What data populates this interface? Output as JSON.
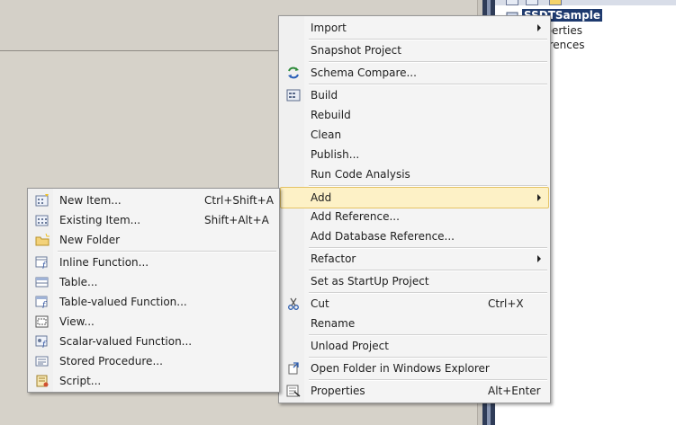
{
  "solution_explorer": {
    "project_label": "SSDTSample",
    "properties_label": "operties",
    "references_label": "ferences"
  },
  "context_menu": {
    "items": [
      {
        "label": "Import",
        "shortcut": "",
        "submenu": true,
        "icon": ""
      },
      {
        "label": "Snapshot Project",
        "shortcut": "",
        "submenu": false,
        "icon": ""
      },
      {
        "label": "Schema Compare...",
        "shortcut": "",
        "submenu": false,
        "icon": "schema-compare-icon"
      },
      {
        "label": "Build",
        "shortcut": "",
        "submenu": false,
        "icon": "build-icon"
      },
      {
        "label": "Rebuild",
        "shortcut": "",
        "submenu": false,
        "icon": ""
      },
      {
        "label": "Clean",
        "shortcut": "",
        "submenu": false,
        "icon": ""
      },
      {
        "label": "Publish...",
        "shortcut": "",
        "submenu": false,
        "icon": ""
      },
      {
        "label": "Run Code Analysis",
        "shortcut": "",
        "submenu": false,
        "icon": ""
      },
      {
        "label": "Add",
        "shortcut": "",
        "submenu": true,
        "icon": "",
        "highlighted": true
      },
      {
        "label": "Add Reference...",
        "shortcut": "",
        "submenu": false,
        "icon": ""
      },
      {
        "label": "Add Database Reference...",
        "shortcut": "",
        "submenu": false,
        "icon": ""
      },
      {
        "label": "Refactor",
        "shortcut": "",
        "submenu": true,
        "icon": ""
      },
      {
        "label": "Set as StartUp Project",
        "shortcut": "",
        "submenu": false,
        "icon": ""
      },
      {
        "label": "Cut",
        "shortcut": "Ctrl+X",
        "submenu": false,
        "icon": "scissors-icon"
      },
      {
        "label": "Rename",
        "shortcut": "",
        "submenu": false,
        "icon": ""
      },
      {
        "label": "Unload Project",
        "shortcut": "",
        "submenu": false,
        "icon": ""
      },
      {
        "label": "Open Folder in Windows Explorer",
        "shortcut": "",
        "submenu": false,
        "icon": "open-folder-icon"
      },
      {
        "label": "Properties",
        "shortcut": "Alt+Enter",
        "submenu": false,
        "icon": "properties-icon"
      }
    ]
  },
  "add_submenu": {
    "items": [
      {
        "label": "New Item...",
        "shortcut": "Ctrl+Shift+A",
        "icon": "new-item-icon"
      },
      {
        "label": "Existing Item...",
        "shortcut": "Shift+Alt+A",
        "icon": "existing-item-icon"
      },
      {
        "label": "New Folder",
        "shortcut": "",
        "icon": "new-folder-icon"
      },
      {
        "label": "Inline Function...",
        "shortcut": "",
        "icon": "inline-function-icon"
      },
      {
        "label": "Table...",
        "shortcut": "",
        "icon": "table-icon"
      },
      {
        "label": "Table-valued Function...",
        "shortcut": "",
        "icon": "table-valued-function-icon"
      },
      {
        "label": "View...",
        "shortcut": "",
        "icon": "view-icon"
      },
      {
        "label": "Scalar-valued Function...",
        "shortcut": "",
        "icon": "scalar-function-icon"
      },
      {
        "label": "Stored Procedure...",
        "shortcut": "",
        "icon": "stored-procedure-icon"
      },
      {
        "label": "Script...",
        "shortcut": "",
        "icon": "script-icon"
      }
    ]
  },
  "colors": {
    "highlight_bg": "#fdf1c6",
    "highlight_border": "#e5c365",
    "menu_bg": "#f4f4f4"
  }
}
